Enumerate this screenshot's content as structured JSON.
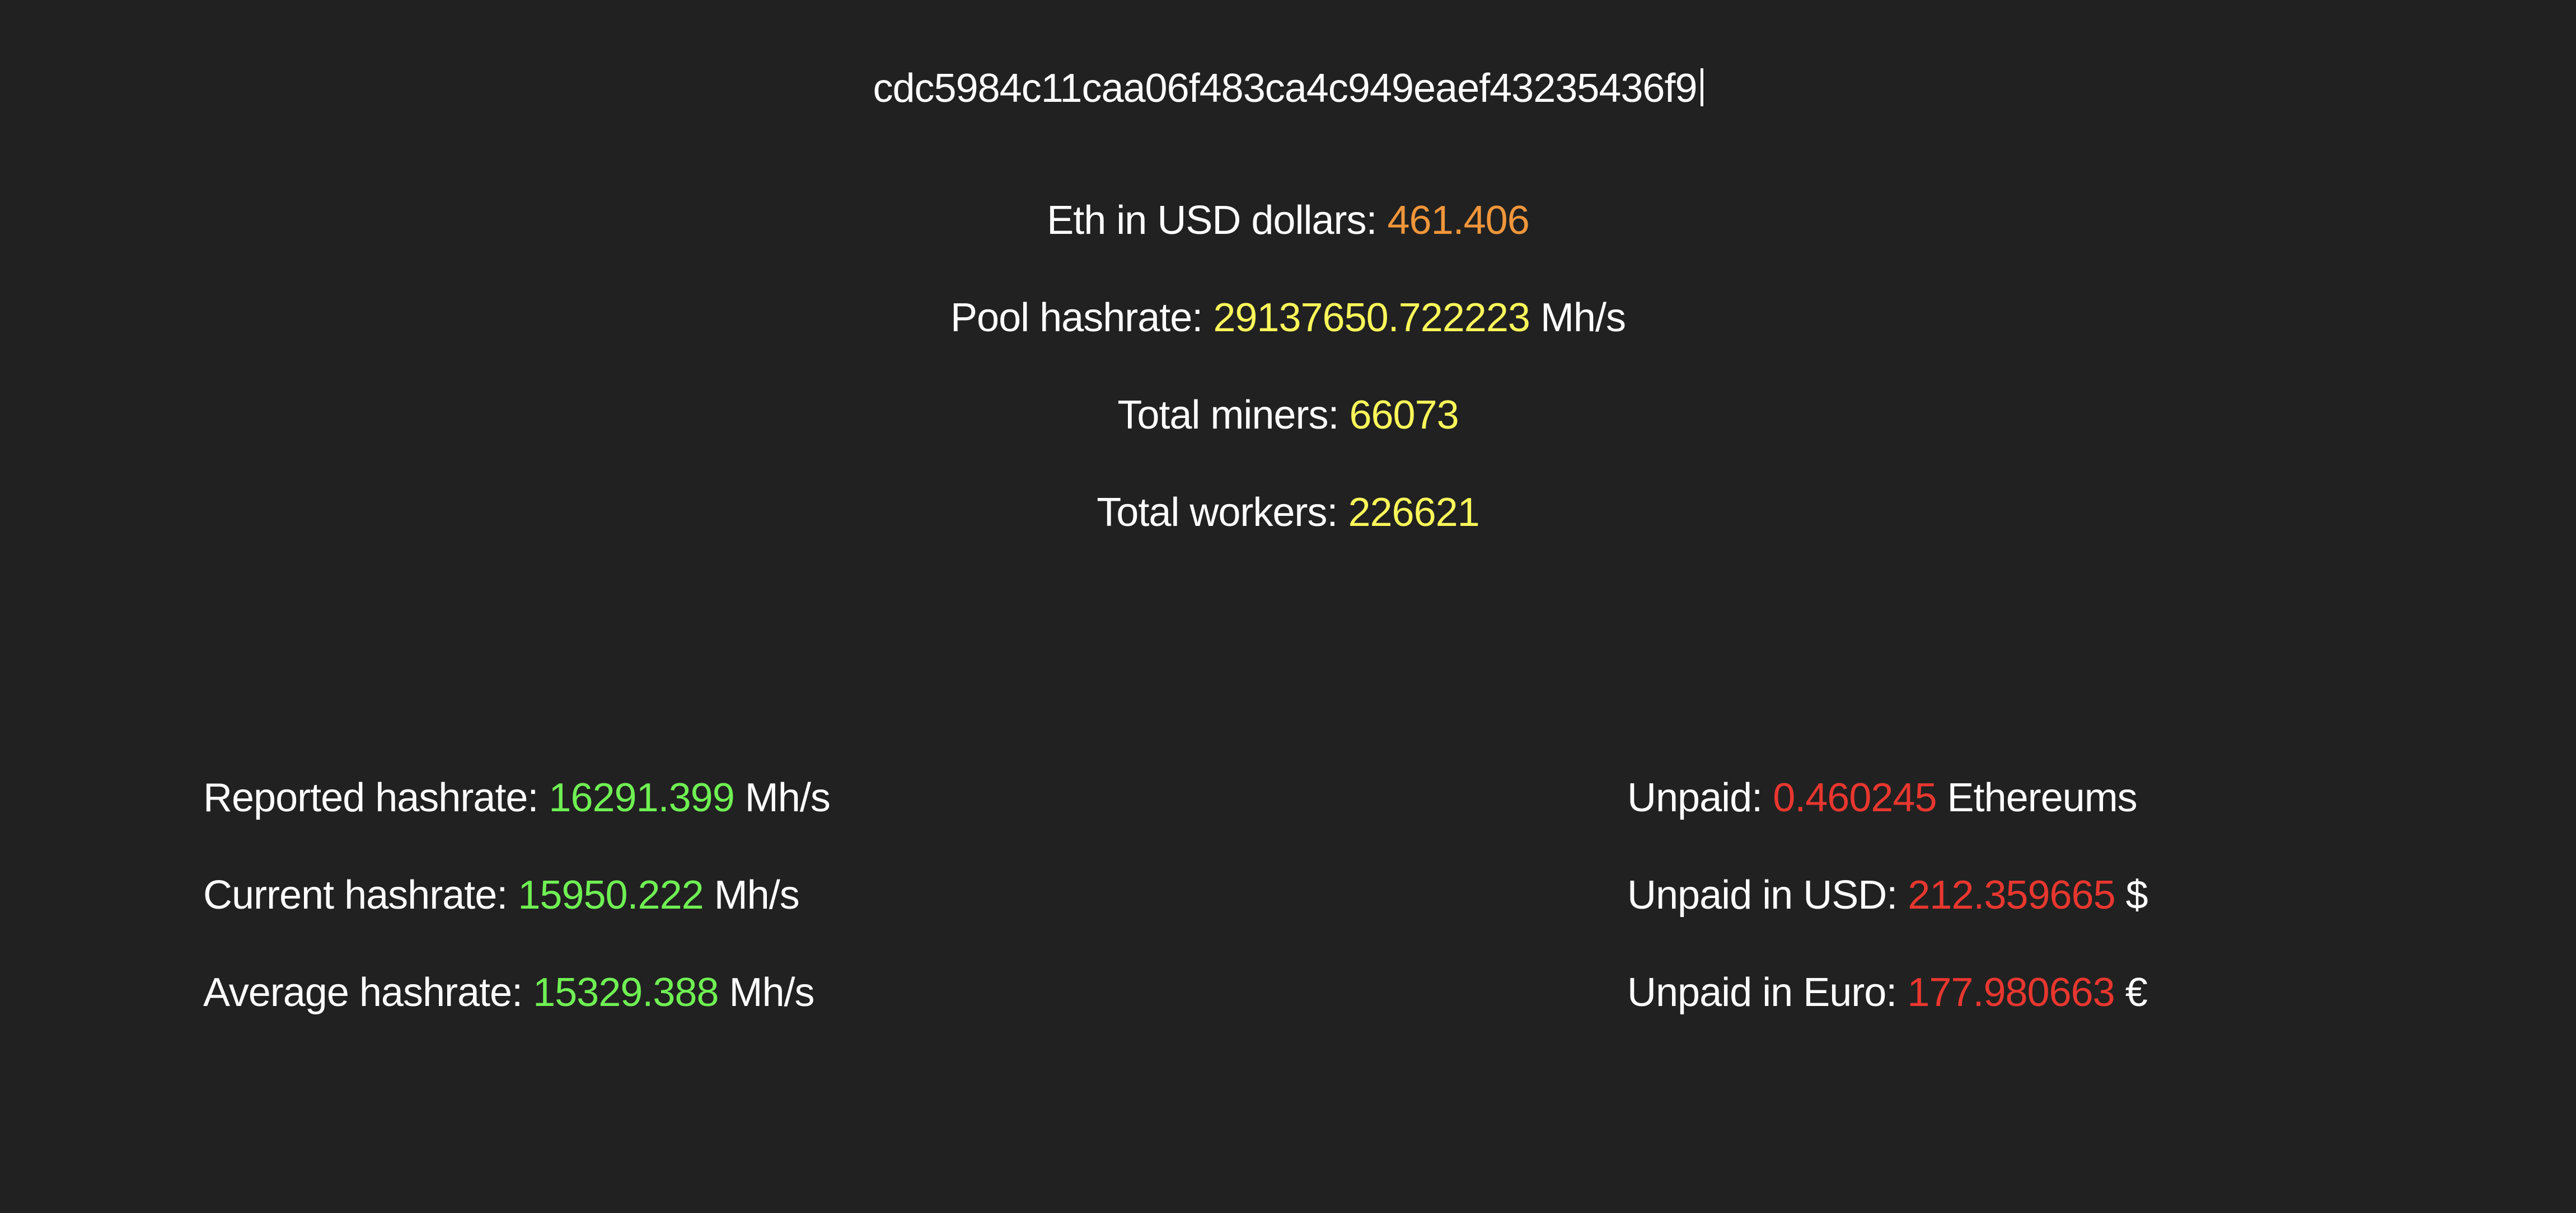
{
  "colors": {
    "background": "#212121",
    "text": "#ffffff",
    "eth_price": "#f0963a",
    "pool_stats": "#fbf75a",
    "hashrate": "#6ff053",
    "unpaid": "#e8372f"
  },
  "header": {
    "address": "cdc5984c11caa06f483ca4c949eaef43235436f9"
  },
  "pool": {
    "eth_price_label": "Eth in USD dollars:",
    "eth_price_value": "461.406",
    "hashrate_label": "Pool hashrate:",
    "hashrate_value": "29137650.722223",
    "hashrate_unit": "Mh/s",
    "miners_label": "Total miners:",
    "miners_value": "66073",
    "workers_label": "Total workers:",
    "workers_value": "226621"
  },
  "hashrates": {
    "reported_label": "Reported hashrate:",
    "reported_value": "16291.399",
    "reported_unit": "Mh/s",
    "current_label": "Current hashrate:",
    "current_value": "15950.222",
    "current_unit": "Mh/s",
    "average_label": "Average hashrate:",
    "average_value": "15329.388",
    "average_unit": "Mh/s"
  },
  "unpaid": {
    "eth_label": "Unpaid:",
    "eth_value": "0.460245",
    "eth_unit": "Ethereums",
    "usd_label": "Unpaid in USD:",
    "usd_value": "212.359665",
    "usd_unit": "$",
    "euro_label": "Unpaid in Euro:",
    "euro_value": "177.980663",
    "euro_unit": "€"
  }
}
